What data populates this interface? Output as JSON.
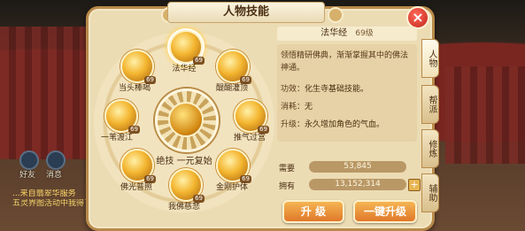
{
  "background": {
    "chat_lines": [
      "...来自翡翠华服务",
      "五灵界图活动中我得了",
      ""
    ],
    "labels": [
      "好友",
      "消息"
    ]
  },
  "panel": {
    "title": "人物技能",
    "close_icon": "×"
  },
  "wheel": {
    "center_label": "绝技  一元复始",
    "skills": [
      {
        "name": "法华经",
        "level": "69"
      },
      {
        "name": "醍醐灌顶",
        "level": "69"
      },
      {
        "name": "推气过宫",
        "level": "69"
      },
      {
        "name": "金刚护体",
        "level": "69"
      },
      {
        "name": "我佛慈悲",
        "level": "69"
      },
      {
        "name": "佛光普照",
        "level": "69"
      },
      {
        "name": "一苇渡江",
        "level": "69"
      },
      {
        "name": "当头棒喝",
        "level": "69"
      }
    ]
  },
  "info": {
    "skill_name": "法华经",
    "skill_level": "69级",
    "description": "领悟精研佛典，渐渐掌握其中的佛法神通。",
    "effect_key": "功效：",
    "effect_val": "化生寺基础技能。",
    "cost_key": "消耗：",
    "cost_val": "无",
    "upgrade_key": "升级：",
    "upgrade_val": "永久增加角色的气血。",
    "need_label": "需要",
    "need_value": "53,845",
    "own_label": "拥有",
    "own_value": "13,152,314",
    "plus_icon": "+",
    "btn_upgrade": "升 级",
    "btn_upgrade_all": "一键升级"
  },
  "side_tabs": [
    "人物",
    "帮派",
    "修炼",
    "辅助"
  ]
}
